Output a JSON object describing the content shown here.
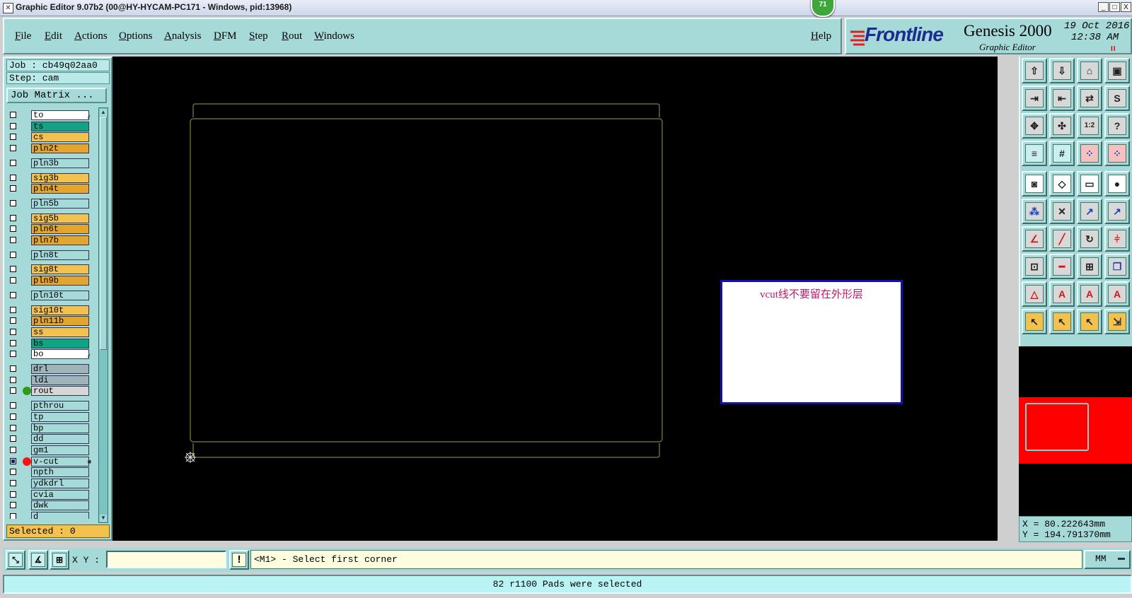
{
  "window": {
    "title": "Graphic Editor 9.07b2 (00@HY-HYCAM-PC171 - Windows, pid:13968)",
    "badge": "71",
    "minimize": "_",
    "maximize": "□",
    "close": "X"
  },
  "menu": {
    "items": [
      "File",
      "Edit",
      "Actions",
      "Options",
      "Analysis",
      "DFM",
      "Step",
      "Rout",
      "Windows"
    ],
    "help": "Help"
  },
  "brand": {
    "logo": "Frontline",
    "product": "Genesis 2000",
    "subtitle": "Graphic Editor",
    "date": "19 Oct 2016",
    "time": "12:38 AM",
    "pause": "II"
  },
  "job": {
    "job_label": "Job : cb49q02aa0",
    "step_label": "Step: cam",
    "matrix_button": "Job Matrix ..."
  },
  "layers": [
    {
      "name": "to",
      "color": "#ffffff",
      "tag": "⸙"
    },
    {
      "name": "ts",
      "color": "#12a383"
    },
    {
      "name": "cs",
      "color": "#f2c14e"
    },
    {
      "name": "pln2t",
      "color": "#e3a52d"
    },
    {
      "name": "pln3b",
      "color": "#a6dad9"
    },
    {
      "name": "sig3b",
      "color": "#f2c14e"
    },
    {
      "name": "pln4t",
      "color": "#e3a52d"
    },
    {
      "name": "pln5b",
      "color": "#a6dad9"
    },
    {
      "name": "sig5b",
      "color": "#f2c14e"
    },
    {
      "name": "pln6t",
      "color": "#e3a52d"
    },
    {
      "name": "pln7b",
      "color": "#e3a52d"
    },
    {
      "name": "pln8t",
      "color": "#a6dad9"
    },
    {
      "name": "sig8t",
      "color": "#f2c14e"
    },
    {
      "name": "pln9b",
      "color": "#e3a52d"
    },
    {
      "name": "pln10t",
      "color": "#a6dad9"
    },
    {
      "name": "sig10t",
      "color": "#f2c14e"
    },
    {
      "name": "pln11b",
      "color": "#e3a52d"
    },
    {
      "name": "ss",
      "color": "#f2c14e"
    },
    {
      "name": "bs",
      "color": "#12a383"
    },
    {
      "name": "bo",
      "color": "#ffffff",
      "tag": "⸙"
    },
    {
      "name": "drl",
      "color": "#9fb3b8"
    },
    {
      "name": "ldi",
      "color": "#9fb3b8"
    },
    {
      "name": "rout",
      "color": "#d6d6d6",
      "dot": "#2e9a1a"
    },
    {
      "name": "pthrou",
      "color": "#a6dad9"
    },
    {
      "name": "tp",
      "color": "#a6dad9"
    },
    {
      "name": "bp",
      "color": "#a6dad9"
    },
    {
      "name": "dd",
      "color": "#a6dad9"
    },
    {
      "name": "gm1",
      "color": "#a6dad9"
    },
    {
      "name": "v-cut",
      "color": "#a6dad9",
      "dot": "#ff1010",
      "checked": true,
      "tag": "■"
    },
    {
      "name": "npth",
      "color": "#a6dad9"
    },
    {
      "name": "ydkdrl",
      "color": "#a6dad9"
    },
    {
      "name": "cvia",
      "color": "#a6dad9"
    },
    {
      "name": "dwk",
      "color": "#a6dad9"
    },
    {
      "name": "d",
      "color": "#a6dad9"
    }
  ],
  "selected_label": "Selected : 0",
  "note": {
    "text": "vcut线不要留在外形层"
  },
  "coords": {
    "x": "X = 80.222643mm",
    "y": "Y = 194.791370mm"
  },
  "prompt": {
    "xy_label": "X Y :",
    "xy_value": "",
    "warn": "!",
    "message": "<M1> - Select first corner",
    "units": "MM"
  },
  "status": "82 r1100 Pads were selected",
  "tools": [
    {
      "icon": "layer-up-icon",
      "glyph": "⇧",
      "style": "grey"
    },
    {
      "icon": "layer-down-icon",
      "glyph": "⇩",
      "style": "grey"
    },
    {
      "icon": "home-icon",
      "glyph": "⌂",
      "style": "grey"
    },
    {
      "icon": "window-icon",
      "glyph": "▣",
      "style": "grey"
    },
    {
      "icon": "step-in-icon",
      "glyph": "⇥",
      "style": "grey"
    },
    {
      "icon": "step-out-icon",
      "glyph": "⇤",
      "style": "grey"
    },
    {
      "icon": "swap-icon",
      "glyph": "⇄",
      "style": "grey"
    },
    {
      "icon": "s-curve-icon",
      "glyph": "S",
      "style": "grey"
    },
    {
      "icon": "fit-icon",
      "glyph": "✥",
      "style": "grey"
    },
    {
      "icon": "zoom-out-icon",
      "glyph": "✣",
      "style": "grey"
    },
    {
      "icon": "scale-icon",
      "glyph": "1:2",
      "style": "grey"
    },
    {
      "icon": "help-icon",
      "glyph": "?",
      "style": "grey"
    },
    {
      "icon": "settings-icon",
      "glyph": "≡",
      "style": ""
    },
    {
      "icon": "grid-icon",
      "glyph": "#",
      "style": ""
    },
    {
      "icon": "net-icon",
      "glyph": "⁘",
      "style": "red"
    },
    {
      "icon": "net2-icon",
      "glyph": "⁘",
      "style": "red"
    },
    {
      "icon": "pad-icon",
      "glyph": "◙",
      "style": "white"
    },
    {
      "icon": "select-shape-icon",
      "glyph": "◇",
      "style": "white"
    },
    {
      "icon": "ruler-icon",
      "glyph": "▭",
      "style": "white"
    },
    {
      "icon": "dot-icon",
      "glyph": "●",
      "style": "white"
    },
    {
      "icon": "node-icon",
      "glyph": "⁂",
      "style": "grey"
    },
    {
      "icon": "cross-icon",
      "glyph": "✕",
      "style": "grey"
    },
    {
      "icon": "point-icon",
      "glyph": "↗",
      "style": "grey"
    },
    {
      "icon": "point2-icon",
      "glyph": "↗",
      "style": "grey"
    },
    {
      "icon": "angle-icon",
      "glyph": "∠",
      "style": "grey"
    },
    {
      "icon": "line-icon",
      "glyph": "╱",
      "style": "grey"
    },
    {
      "icon": "rotate-icon",
      "glyph": "↻",
      "style": "grey"
    },
    {
      "icon": "mirror-icon",
      "glyph": "⫩",
      "style": "grey"
    },
    {
      "icon": "move-icon",
      "glyph": "⊡",
      "style": "grey"
    },
    {
      "icon": "bar-icon",
      "glyph": "━",
      "style": "grey"
    },
    {
      "icon": "dimension-icon",
      "glyph": "⊞",
      "style": "grey"
    },
    {
      "icon": "copy-icon",
      "glyph": "❐",
      "style": "grey"
    },
    {
      "icon": "triangle-icon",
      "glyph": "△",
      "style": "grey"
    },
    {
      "icon": "text-a-icon",
      "glyph": "A",
      "style": "grey"
    },
    {
      "icon": "text-a2-icon",
      "glyph": "A",
      "style": "grey"
    },
    {
      "icon": "text-a3-icon",
      "glyph": "A",
      "style": "grey"
    },
    {
      "icon": "pointer-icon",
      "glyph": "↖",
      "style": "orange"
    },
    {
      "icon": "pointer-box-icon",
      "glyph": "↖",
      "style": "orange"
    },
    {
      "icon": "pointer-octagon-icon",
      "glyph": "↖",
      "style": "orange"
    },
    {
      "icon": "pointer-net-icon",
      "glyph": "⇲",
      "style": "orange"
    }
  ]
}
